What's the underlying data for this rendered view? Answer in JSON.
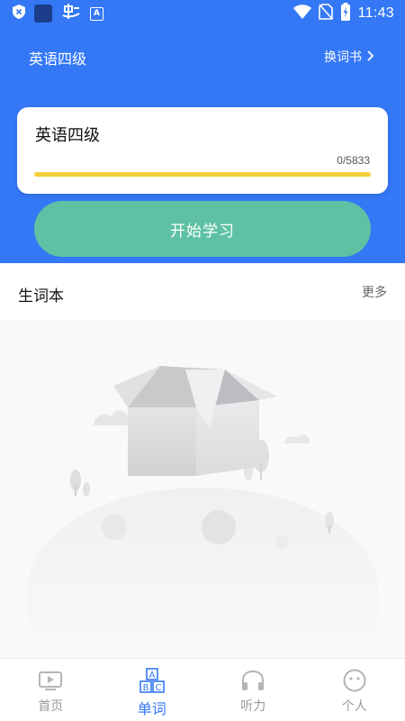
{
  "status_bar": {
    "time": "11:43",
    "left_icons": [
      "shield-x-icon",
      "app-square-icon",
      "bug-icon",
      "a-box-icon"
    ],
    "right_icons": [
      "wifi-icon",
      "no-sim-icon",
      "battery-charging-icon"
    ]
  },
  "header": {
    "title": "英语四级",
    "switch_book_label": "换词书"
  },
  "book_card": {
    "name": "英语四级",
    "progress_text": "0/5833",
    "learned": 0,
    "total": 5833
  },
  "start_button": {
    "label": "开始学习"
  },
  "vocab_book": {
    "title": "生词本",
    "more_label": "更多",
    "empty_illustration": "open-box-on-planet"
  },
  "nav": {
    "items": [
      {
        "label": "首页",
        "icon": "play-screen-icon",
        "active": false
      },
      {
        "label": "单词",
        "icon": "abc-blocks-icon",
        "active": true
      },
      {
        "label": "听力",
        "icon": "headphones-icon",
        "active": false
      },
      {
        "label": "个人",
        "icon": "face-icon",
        "active": false
      }
    ]
  },
  "colors": {
    "primary_blue": "#3478f6",
    "start_green": "#5ec1a3",
    "progress_yellow": "#f5cf3c",
    "nav_active": "#3478f6",
    "nav_inactive": "#9a9a9a"
  }
}
